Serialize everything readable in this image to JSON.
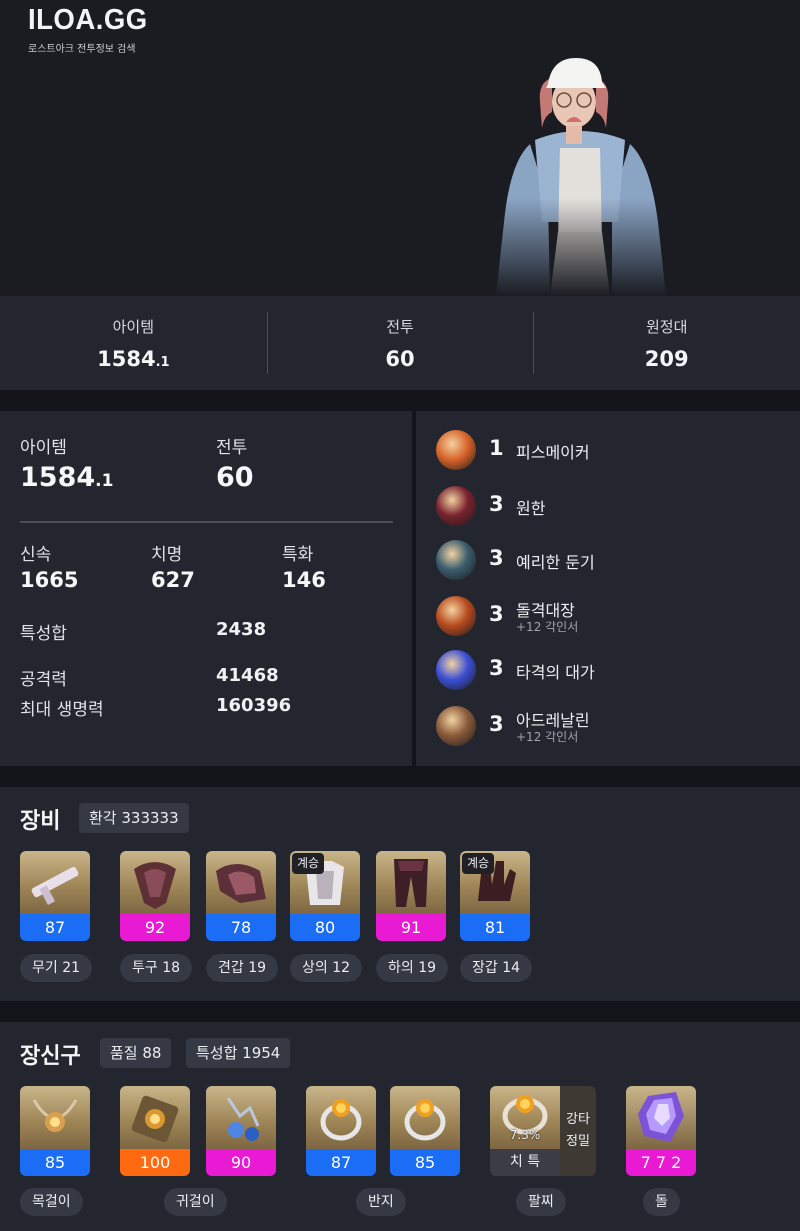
{
  "header": {
    "logo": "ILOA.GG",
    "tagline": "로스트아크 전투정보 검색"
  },
  "summary": [
    {
      "label": "아이템",
      "value_main": "1584",
      "value_frac": ".1"
    },
    {
      "label": "전투",
      "value_main": "60",
      "value_frac": ""
    },
    {
      "label": "원정대",
      "value_main": "209",
      "value_frac": ""
    }
  ],
  "stats": {
    "item_label": "아이템",
    "item_main": "1584",
    "item_frac": ".1",
    "combat_label": "전투",
    "combat_value": "60",
    "swift_label": "신속",
    "swift_value": "1665",
    "crit_label": "치명",
    "crit_value": "627",
    "spec_label": "특화",
    "spec_value": "146",
    "total_label": "특성합",
    "total_value": "2438",
    "atk_label": "공격력",
    "atk_value": "41468",
    "hp_label": "최대 생명력",
    "hp_value": "160396"
  },
  "engravings": [
    {
      "level": "1",
      "name": "피스메이커",
      "sub": "",
      "icon": "peacemaker-icon",
      "color": "#d9632a"
    },
    {
      "level": "3",
      "name": "원한",
      "sub": "",
      "icon": "grudge-icon",
      "color": "#7a2230"
    },
    {
      "level": "3",
      "name": "예리한 둔기",
      "sub": "",
      "icon": "keen-blunt-weapon-icon",
      "color": "#3a5d6e"
    },
    {
      "level": "3",
      "name": "돌격대장",
      "sub": "+12 각인서",
      "icon": "raid-captain-icon",
      "color": "#b84a1e"
    },
    {
      "level": "3",
      "name": "타격의 대가",
      "sub": "",
      "icon": "master-of-strikes-icon",
      "color": "#3b4fd6"
    },
    {
      "level": "3",
      "name": "아드레날린",
      "sub": "+12 각인서",
      "icon": "adrenaline-icon",
      "color": "#8a5a3a"
    }
  ],
  "equipment": {
    "title": "장비",
    "transcend": "환각 333333",
    "items": [
      {
        "quality": "87",
        "label": "무기 21",
        "tier": "blue",
        "inherit": "",
        "icon": "weapon-icon"
      },
      {
        "quality": "92",
        "label": "투구 18",
        "tier": "pink",
        "inherit": "",
        "icon": "helmet-icon"
      },
      {
        "quality": "78",
        "label": "견갑 19",
        "tier": "blue",
        "inherit": "",
        "icon": "shoulder-icon"
      },
      {
        "quality": "80",
        "label": "상의 12",
        "tier": "blue",
        "inherit": "계승",
        "icon": "chest-icon"
      },
      {
        "quality": "91",
        "label": "하의 19",
        "tier": "pink",
        "inherit": "",
        "icon": "pants-icon"
      },
      {
        "quality": "81",
        "label": "장갑 14",
        "tier": "blue",
        "inherit": "계승",
        "icon": "gloves-icon"
      }
    ]
  },
  "accessories": {
    "title": "장신구",
    "quality_chip": "품질 88",
    "stat_chip": "특성합 1954",
    "items": [
      {
        "quality": "85",
        "tier": "blue",
        "icon": "necklace-icon"
      },
      {
        "quality": "100",
        "tier": "orange",
        "icon": "earring-icon"
      },
      {
        "quality": "90",
        "tier": "pink",
        "icon": "earring-icon"
      },
      {
        "quality": "87",
        "tier": "blue",
        "icon": "ring-icon"
      },
      {
        "quality": "85",
        "tier": "blue",
        "icon": "ring-icon"
      }
    ],
    "bracelet": {
      "pct": "7.3%",
      "stats": "치 특",
      "side1": "강타",
      "side2": "정밀"
    },
    "stone": {
      "value": "7 7 2"
    },
    "labels": {
      "necklace": "목걸이",
      "earring": "귀걸이",
      "ring": "반지",
      "bracelet": "팔찌",
      "stone": "돌"
    }
  }
}
